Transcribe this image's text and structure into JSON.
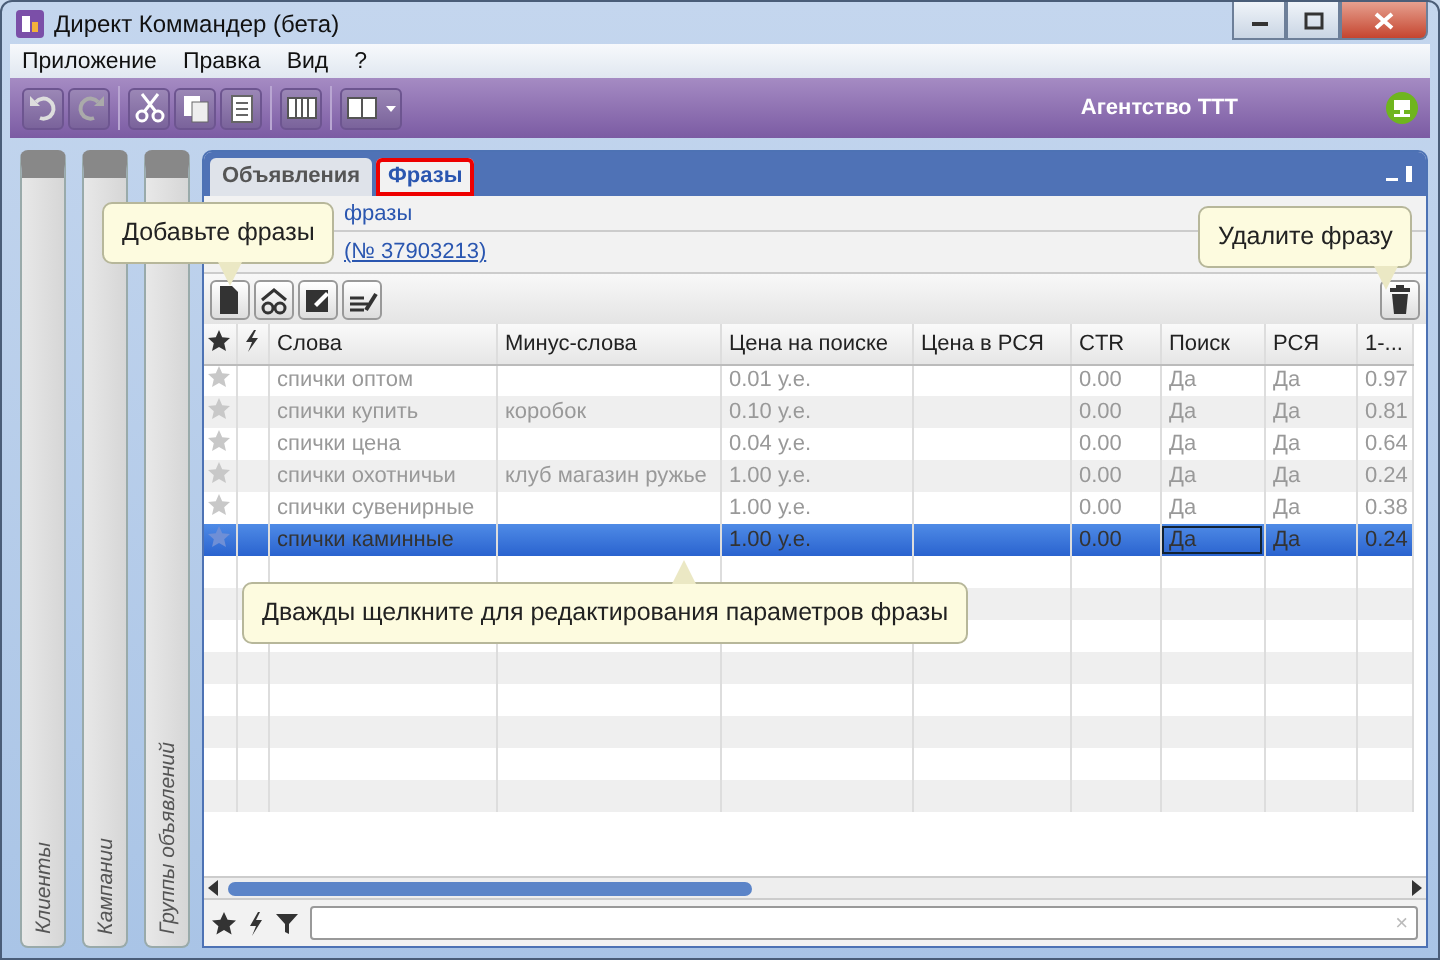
{
  "window": {
    "title": "Директ Коммандер (бета)"
  },
  "menu": [
    "Приложение",
    "Правка",
    "Вид",
    "?"
  ],
  "toolbar": {
    "account": "Агентство ТТТ"
  },
  "side_panels": [
    {
      "label": "Клиенты"
    },
    {
      "label": "Кампании"
    },
    {
      "label": "Группы объявлений"
    }
  ],
  "tabs": [
    {
      "label": "Объявления",
      "selected": false
    },
    {
      "label": "Фразы",
      "selected": true
    }
  ],
  "breadcrumb": "фразы",
  "group_link": "(№ 37903213)",
  "table": {
    "columns": [
      "Слова",
      "Минус-слова",
      "Цена на поиске",
      "Цена в РСЯ",
      "CTR",
      "Поиск",
      "РСЯ",
      "1-..."
    ],
    "rows": [
      {
        "selected": false,
        "words": "спички оптом",
        "price_search": "0.01 у.е.",
        "ctr": "0.00",
        "search": "Да",
        "rsya": "Да",
        "col_8": "0.97"
      },
      {
        "selected": false,
        "words": "спички купить",
        "minus": "коробок",
        "price_search": "0.10 у.е.",
        "ctr": "0.00",
        "search": "Да",
        "rsya": "Да",
        "col_8": "0.81"
      },
      {
        "selected": false,
        "words": "спички цена",
        "price_search": "0.04 у.е.",
        "ctr": "0.00",
        "search": "Да",
        "rsya": "Да",
        "col_8": "0.64"
      },
      {
        "selected": false,
        "words": "спички охотничьи",
        "minus": "клуб магазин ружье",
        "price_search": "1.00 у.е.",
        "ctr": "0.00",
        "search": "Да",
        "rsya": "Да",
        "col_8": "0.24"
      },
      {
        "selected": false,
        "words": "спички сувенирные",
        "price_search": "1.00 у.е.",
        "ctr": "0.00",
        "search": "Да",
        "rsya": "Да",
        "col_8": "0.38"
      },
      {
        "selected": true,
        "words": "спички каминные",
        "price_search": "1.00 у.е.",
        "ctr": "0.00",
        "search": "Да",
        "rsya": "Да",
        "col_8": "0.24"
      }
    ]
  },
  "callouts": [
    {
      "kind": "add",
      "text": "Добавьте фразы"
    },
    {
      "kind": "delete",
      "text": "Удалите фразу"
    },
    {
      "kind": "edit",
      "text": "Дважды щелкните для редактирования параметров фразы"
    }
  ],
  "filter": {
    "clear": "×"
  }
}
